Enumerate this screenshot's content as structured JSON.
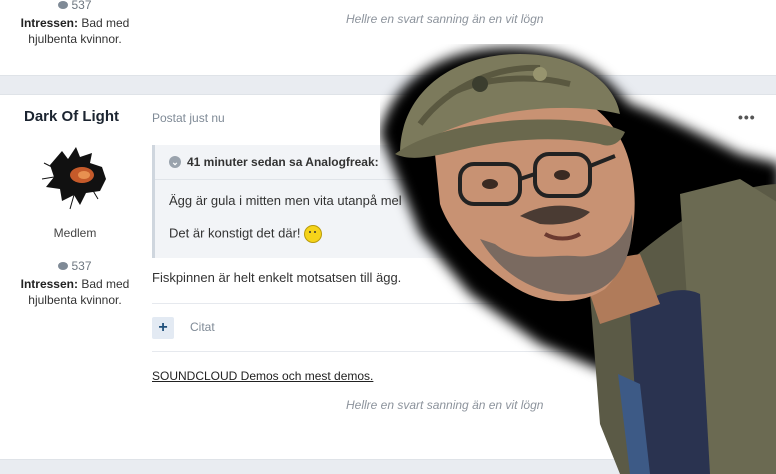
{
  "post_prev": {
    "comment_count": "537",
    "interests_label": "Intressen:",
    "interests_value": "Bad med hjulbenta kvinnor.",
    "signature": "Hellre en svart sanning än en vit lögn"
  },
  "post": {
    "author": "Dark Of Light",
    "role": "Medlem",
    "comment_count": "537",
    "interests_label": "Intressen:",
    "interests_value": "Bad med hjulbenta kvinnor.",
    "posted": "Postat just nu",
    "menu": "•••",
    "quote": {
      "header": "41 minuter sedan sa Analogfreak:",
      "line1": "Ägg är gula i mitten men vita utanpå mel",
      "line2": "Det är konstigt det där!"
    },
    "text": "Fiskpinnen är helt enkelt motsatsen till ägg.",
    "cite_button": "+",
    "cite_label": "Citat",
    "link_text": "SOUNDCLOUD Demos och mest demos.",
    "signature": "Hellre en svart sanning än en vit lögn"
  },
  "icons": {
    "comment": "speech-bubble-icon",
    "quote": "chevron-down-icon",
    "smiley": "smiley-icon",
    "menu": "more-horizontal-icon"
  }
}
